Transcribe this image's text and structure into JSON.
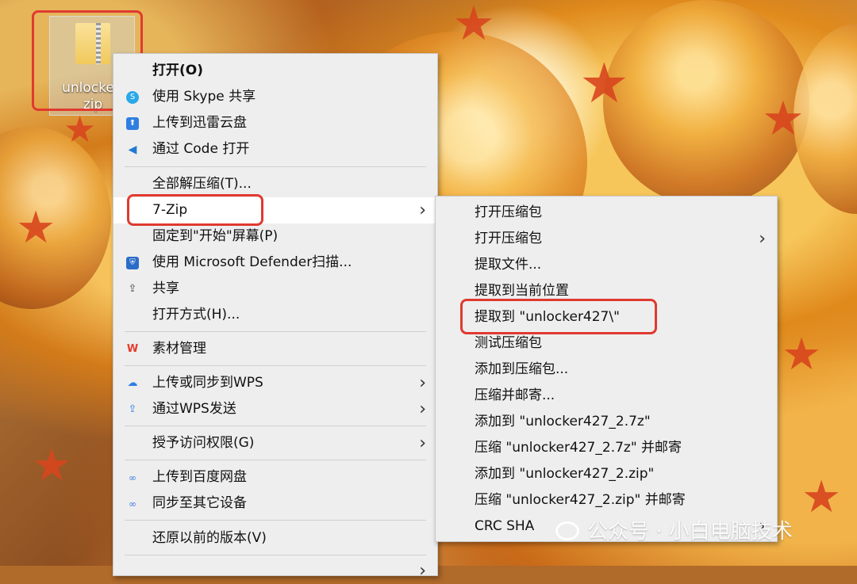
{
  "desktop": {
    "file_label": "unlocker427.zip",
    "file_label_line1": "unlocker-",
    "file_label_line2": "zip"
  },
  "context_menu": {
    "items": [
      {
        "label": "打开(O)",
        "icon": ""
      },
      {
        "label": "使用 Skype 共享",
        "icon": "skype-icon"
      },
      {
        "label": "上传到迅雷云盘",
        "icon": "xunlei-icon"
      },
      {
        "label": "通过 Code 打开",
        "icon": "vscode-icon"
      },
      {
        "label": "全部解压缩(T)...",
        "icon": ""
      },
      {
        "label": "7-Zip",
        "icon": ""
      },
      {
        "label": "固定到\"开始\"屏幕(P)",
        "icon": ""
      },
      {
        "label": "使用 Microsoft Defender扫描...",
        "icon": "defender-icon"
      },
      {
        "label": "共享",
        "icon": "share-icon"
      },
      {
        "label": "打开方式(H)...",
        "icon": ""
      },
      {
        "label": "素材管理",
        "icon": "wps-icon"
      },
      {
        "label": "上传或同步到WPS",
        "icon": "wps-cloud-icon"
      },
      {
        "label": "通过WPS发送",
        "icon": "wps-send-icon"
      },
      {
        "label": "授予访问权限(G)",
        "icon": ""
      },
      {
        "label": "上传到百度网盘",
        "icon": "baidu-icon"
      },
      {
        "label": "同步至其它设备",
        "icon": "baidu-sync-icon"
      },
      {
        "label": "还原以前的版本(V)",
        "icon": ""
      }
    ]
  },
  "submenu_7zip": {
    "items": [
      {
        "label": "打开压缩包"
      },
      {
        "label": "打开压缩包"
      },
      {
        "label": "提取文件..."
      },
      {
        "label": "提取到当前位置"
      },
      {
        "label": "提取到 \"unlocker427\\\""
      },
      {
        "label": "测试压缩包"
      },
      {
        "label": "添加到压缩包..."
      },
      {
        "label": "压缩并邮寄..."
      },
      {
        "label": "添加到 \"unlocker427_2.7z\""
      },
      {
        "label": "压缩 \"unlocker427_2.7z\" 并邮寄"
      },
      {
        "label": "添加到 \"unlocker427_2.zip\""
      },
      {
        "label": "压缩 \"unlocker427_2.zip\" 并邮寄"
      },
      {
        "label": "CRC SHA"
      }
    ]
  },
  "watermark": "公众号 · 小白电脑技术",
  "colors": {
    "highlight_box": "#e03a30",
    "menu_bg": "#eeeeee",
    "hover_bg": "#ffffff"
  }
}
